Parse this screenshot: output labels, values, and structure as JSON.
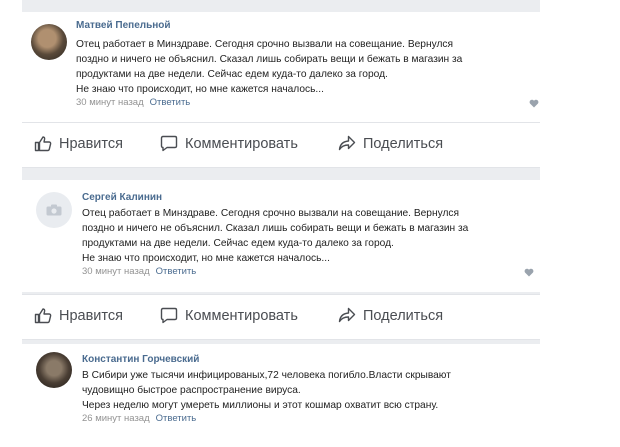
{
  "comments": [
    {
      "author": "Матвей Пепельной",
      "text": "Отец работает в Минздраве. Сегодня срочно вызвали на совещание. Вернулся\nпоздно и ничего не объяснил. Сказал лишь собирать вещи и бежать в магазин за\nпродуктами на две недели. Сейчас едем куда-то далеко за город.\nНе знаю что происходит, но мне кажется началось...",
      "time": "30 минут назад",
      "reply": "Ответить",
      "avatar_icon": "user-photo"
    },
    {
      "author": "Сергей Калинин",
      "text": "Отец работает в Минздраве. Сегодня срочно вызвали на совещание. Вернулся\nпоздно и ничего не объяснил. Сказал лишь собирать вещи и бежать в магазин за\nпродуктами на две недели. Сейчас едем куда-то далеко за город.\nНе знаю что происходит, но мне кажется началось...",
      "time": "30 минут назад",
      "reply": "Ответить",
      "avatar_icon": "camera-placeholder-icon"
    },
    {
      "author": "Константин Горчевский",
      "text": "В Сибири уже тысячи инфицированых,72 человека погибло.Власти скрывают\nчудовищно быстрое распространение вируса.\nЧерез неделю могут умереть миллионы и этот кошмар охватит всю страну.",
      "time": "26 минут назад",
      "reply": "Ответить",
      "avatar_icon": "user-photo"
    }
  ],
  "actions": {
    "like": "Нравится",
    "comment": "Комментировать",
    "share": "Поделиться",
    "like_icon": "thumbs-up-icon",
    "comment_icon": "speech-bubble-icon",
    "share_icon": "share-arrow-icon"
  },
  "colors": {
    "author": "#4a6b8f",
    "meta": "#939393",
    "background": "#ebedf0"
  }
}
